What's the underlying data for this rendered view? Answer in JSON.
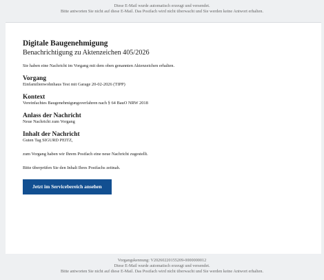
{
  "header": {
    "line1": "Diese E-Mail wurde automatisch erzeugt und versendet.",
    "line2": "Bitte antworten Sie nicht auf diese E-Mail. Das Postfach wird nicht überwacht und Sie werden keine Antwort erhalten."
  },
  "email": {
    "title": "Digitale Baugenehmigung",
    "subtitle": "Benachrichtigung zu Aktenzeichen 405/2026",
    "intro": "Sie haben eine Nachricht im Vorgang mit dem oben genannten Aktenzeichen erhalten.",
    "sections": [
      {
        "heading": "Vorgang",
        "text": "Einfamilienwohnhaus Test mit Garage 20-02-2026 (TIPP)"
      },
      {
        "heading": "Kontext",
        "text": "Vereinfachtes Baugenehmigungsverfahren nach § 64 BauO NRW 2018"
      },
      {
        "heading": "Anlass der Nachricht",
        "text": "Neue Nachricht zum Vorgang"
      },
      {
        "heading": "Inhalt der Nachricht",
        "text": "Guten Tag SIGURD PEITZ,"
      }
    ],
    "body_line1": "zum Vorgang haben wir Ihrem Postfach eine neue Nachricht zugestellt.",
    "body_line2": "Bitte überprüfen Sie den Inhalt Ihres Postfachs zeitnah.",
    "button_label": "Jetzt im Servicebereich ansehen",
    "button_color": "#124f91"
  },
  "footer": {
    "id_line": "Vorgangskennung: V20260220155209-0000000012",
    "line1": "Diese E-Mail wurde automatisch erzeugt und versendet.",
    "line2": "Bitte antworten Sie nicht auf diese E-Mail. Das Postfach wird nicht überwacht und Sie werden keine Antwort erhalten."
  }
}
